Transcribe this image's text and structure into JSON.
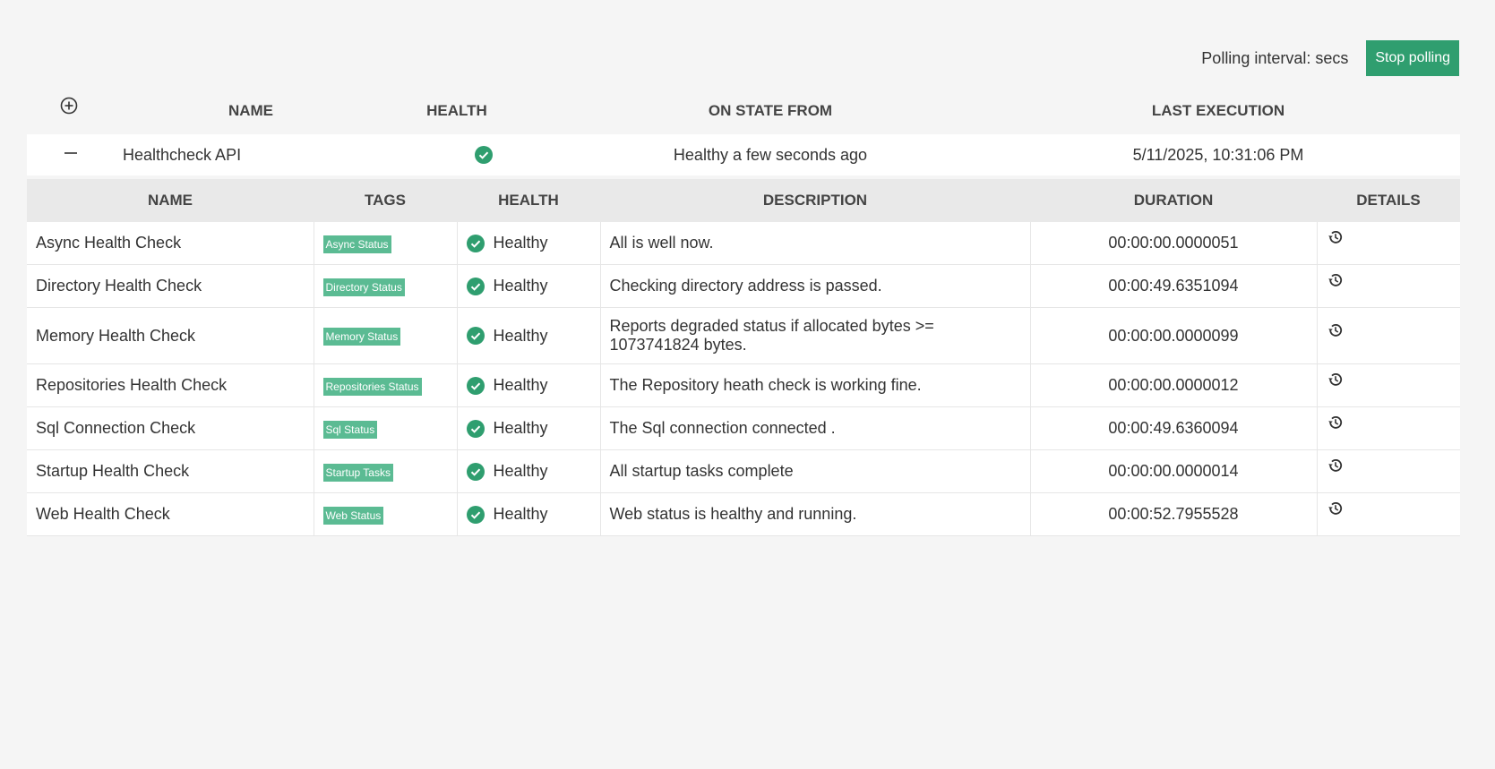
{
  "toolbar": {
    "polling_label": "Polling interval: secs",
    "stop_label": "Stop polling",
    "stop_color": "#2f9e6f"
  },
  "header": {
    "add_icon": "circle-plus-icon",
    "name": "NAME",
    "health": "HEALTH",
    "on_state_from": "ON STATE FROM",
    "last_execution": "LAST EXECUTION"
  },
  "api": {
    "collapse_icon": "minus-icon",
    "name": "Healthcheck API",
    "health_icon": "check-circle-icon",
    "on_state_from": "Healthy a few seconds ago",
    "last_execution": "5/11/2025, 10:31:06 PM"
  },
  "checks_table": {
    "columns": [
      "NAME",
      "TAGS",
      "HEALTH",
      "DESCRIPTION",
      "DURATION",
      "DETAILS"
    ],
    "tag_color": "#5bbb93",
    "healthy_color": "#2f9e6f",
    "details_icon": "history-icon",
    "rows": [
      {
        "name": "Async Health Check",
        "tag": "Async Status",
        "health": "Healthy",
        "description": "All is well now.",
        "duration": "00:00:00.0000051"
      },
      {
        "name": "Directory Health Check",
        "tag": "Directory Status",
        "health": "Healthy",
        "description": "Checking directory address is passed.",
        "duration": "00:00:49.6351094"
      },
      {
        "name": "Memory Health Check",
        "tag": "Memory Status",
        "health": "Healthy",
        "description": "Reports degraded status if allocated bytes >= 1073741824 bytes.",
        "duration": "00:00:00.0000099"
      },
      {
        "name": "Repositories Health Check",
        "tag": "Repositories Status",
        "health": "Healthy",
        "description": "The Repository heath check is working fine.",
        "duration": "00:00:00.0000012"
      },
      {
        "name": "Sql Connection Check",
        "tag": "Sql Status",
        "health": "Healthy",
        "description": "The Sql connection connected .",
        "duration": "00:00:49.6360094"
      },
      {
        "name": "Startup Health Check",
        "tag": "Startup Tasks",
        "health": "Healthy",
        "description": "All startup tasks complete",
        "duration": "00:00:00.0000014"
      },
      {
        "name": "Web Health Check",
        "tag": "Web Status",
        "health": "Healthy",
        "description": "Web status is healthy and running.",
        "duration": "00:00:52.7955528"
      }
    ]
  }
}
